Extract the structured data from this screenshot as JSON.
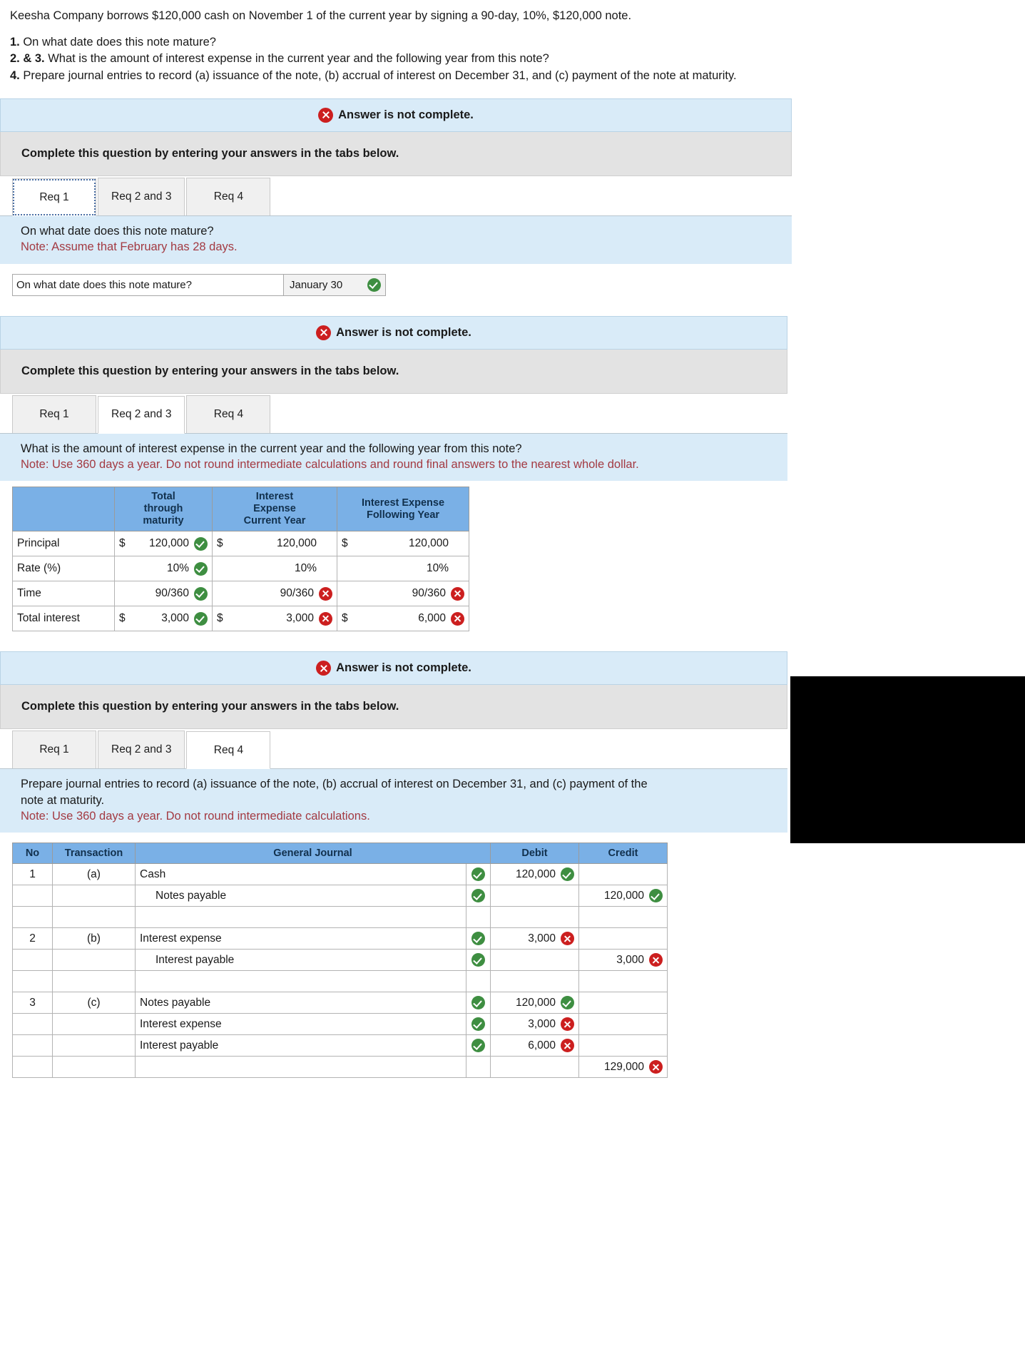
{
  "problem": {
    "stem": "Keesha Company borrows $120,000 cash on November 1 of the current year by signing a 90-day, 10%, $120,000 note.",
    "requirements": [
      {
        "num": "1.",
        "text_before": " On what date does this note mature?",
        "parts": []
      },
      {
        "num": "2. & 3.",
        "text_before": " What is the amount of interest expense in the current year and the following year from this note?",
        "parts": []
      },
      {
        "num": "4.",
        "text_before": " Prepare journal entries to record (a) issuance of the note, (b) accrual of interest on December 31, and (c) payment of the note at maturity.",
        "parts": []
      }
    ],
    "req4_line1a": "Prepare journal entries to record (",
    "req4_italic_a": "a",
    "req4_line1b": ") issuance of the note, (",
    "req4_italic_b": "b",
    "req4_line1c": ") accrual of interest on December 31, and (",
    "req4_italic_c": "c",
    "req4_line1d": ") payment of the note at"
  },
  "notice": {
    "text": "Answer is not complete.",
    "icon": "circle-x-icon"
  },
  "complete_bar": {
    "text": "Complete this question by entering your answers in the tabs below."
  },
  "tabs": {
    "req1": "Req 1",
    "req23": "Req 2 and 3",
    "req4": "Req 4"
  },
  "panel1": {
    "question": "On what date does this note mature?",
    "note": "Note: Assume that February has 28 days.",
    "answer_label": "On what date does this note mature?",
    "answer_value": "January 30",
    "answer_status": "check"
  },
  "panel2": {
    "question": "What is the amount of interest expense in the current year and the following year from this note?",
    "note": "Note: Use 360 days a year. Do not round intermediate calculations and round final answers to the nearest whole dollar.",
    "table": {
      "headers": [
        "",
        "Total through maturity",
        "Interest Expense Current Year",
        "Interest Expense Following Year"
      ],
      "header_lines": [
        [
          ""
        ],
        [
          "Total",
          "through",
          "maturity"
        ],
        [
          "Interest",
          "Expense",
          "Current Year"
        ],
        [
          "Interest Expense",
          "Following Year"
        ]
      ],
      "rows": [
        {
          "label": "Principal",
          "cells": [
            {
              "currency": "$",
              "value": "120,000",
              "status": "check"
            },
            {
              "currency": "$",
              "value": "120,000",
              "status": "none"
            },
            {
              "currency": "$",
              "value": "120,000",
              "status": "none"
            }
          ]
        },
        {
          "label": "Rate (%)",
          "cells": [
            {
              "currency": "",
              "value": "10%",
              "status": "check"
            },
            {
              "currency": "",
              "value": "10%",
              "status": "none"
            },
            {
              "currency": "",
              "value": "10%",
              "status": "none"
            }
          ]
        },
        {
          "label": "Time",
          "cells": [
            {
              "currency": "",
              "value": "90/360",
              "status": "check"
            },
            {
              "currency": "",
              "value": "90/360",
              "status": "cross"
            },
            {
              "currency": "",
              "value": "90/360",
              "status": "cross"
            }
          ]
        },
        {
          "label": "Total interest",
          "cells": [
            {
              "currency": "$",
              "value": "3,000",
              "status": "check"
            },
            {
              "currency": "$",
              "value": "3,000",
              "status": "cross"
            },
            {
              "currency": "$",
              "value": "6,000",
              "status": "cross"
            }
          ]
        }
      ]
    }
  },
  "panel3": {
    "question_line1": "Prepare journal entries to record (a) issuance of the note, (b) accrual of interest on December 31, and (c) payment of the",
    "question_line2": "note at maturity.",
    "note": "Note: Use 360 days a year. Do not round intermediate calculations.",
    "journal": {
      "headers": {
        "no": "No",
        "transaction": "Transaction",
        "general_journal": "General Journal",
        "debit": "Debit",
        "credit": "Credit"
      },
      "rows": [
        {
          "no": "1",
          "transaction": "(a)",
          "account": "Cash",
          "indent": false,
          "account_status": "check",
          "debit": "120,000",
          "debit_status": "check",
          "credit": "",
          "credit_status": "none",
          "debit_tint": "ok",
          "credit_tint": "none"
        },
        {
          "no": "",
          "transaction": "",
          "account": "Notes payable",
          "indent": true,
          "account_status": "check",
          "debit": "",
          "debit_status": "none",
          "credit": "120,000",
          "credit_status": "check",
          "debit_tint": "none",
          "credit_tint": "ok"
        },
        {
          "no": "",
          "transaction": "",
          "account": "",
          "indent": false,
          "account_status": "none",
          "debit": "",
          "debit_status": "none",
          "credit": "",
          "credit_status": "none",
          "debit_tint": "none",
          "credit_tint": "none"
        },
        {
          "no": "2",
          "transaction": "(b)",
          "account": "Interest expense",
          "indent": false,
          "account_status": "check",
          "debit": "3,000",
          "debit_status": "cross",
          "credit": "",
          "credit_status": "none",
          "debit_tint": "bad",
          "credit_tint": "none"
        },
        {
          "no": "",
          "transaction": "",
          "account": "Interest payable",
          "indent": true,
          "account_status": "check",
          "debit": "",
          "debit_status": "none",
          "credit": "3,000",
          "credit_status": "cross",
          "debit_tint": "none",
          "credit_tint": "bad"
        },
        {
          "no": "",
          "transaction": "",
          "account": "",
          "indent": false,
          "account_status": "none",
          "debit": "",
          "debit_status": "none",
          "credit": "",
          "credit_status": "none",
          "debit_tint": "none",
          "credit_tint": "none"
        },
        {
          "no": "3",
          "transaction": "(c)",
          "account": "Notes payable",
          "indent": false,
          "account_status": "check",
          "debit": "120,000",
          "debit_status": "check",
          "credit": "",
          "credit_status": "none",
          "debit_tint": "ok",
          "credit_tint": "none"
        },
        {
          "no": "",
          "transaction": "",
          "account": "Interest expense",
          "indent": false,
          "account_status": "check",
          "debit": "3,000",
          "debit_status": "cross",
          "credit": "",
          "credit_status": "none",
          "debit_tint": "bad",
          "credit_tint": "none"
        },
        {
          "no": "",
          "transaction": "",
          "account": "Interest payable",
          "indent": false,
          "account_status": "check",
          "debit": "6,000",
          "debit_status": "cross",
          "credit": "",
          "credit_status": "none",
          "debit_tint": "bad",
          "credit_tint": "none"
        },
        {
          "no": "",
          "transaction": "",
          "account": "",
          "indent": false,
          "account_status": "none",
          "debit": "",
          "debit_status": "none",
          "credit": "129,000",
          "credit_status": "cross",
          "debit_tint": "none",
          "credit_tint": "bad"
        }
      ]
    }
  },
  "colors": {
    "notice_bg": "#d9ebf8",
    "header_blue": "#7ab0e6",
    "note_red": "#a33a42",
    "ok_green": "#3e8e41",
    "bad_red": "#cc1f1f"
  }
}
